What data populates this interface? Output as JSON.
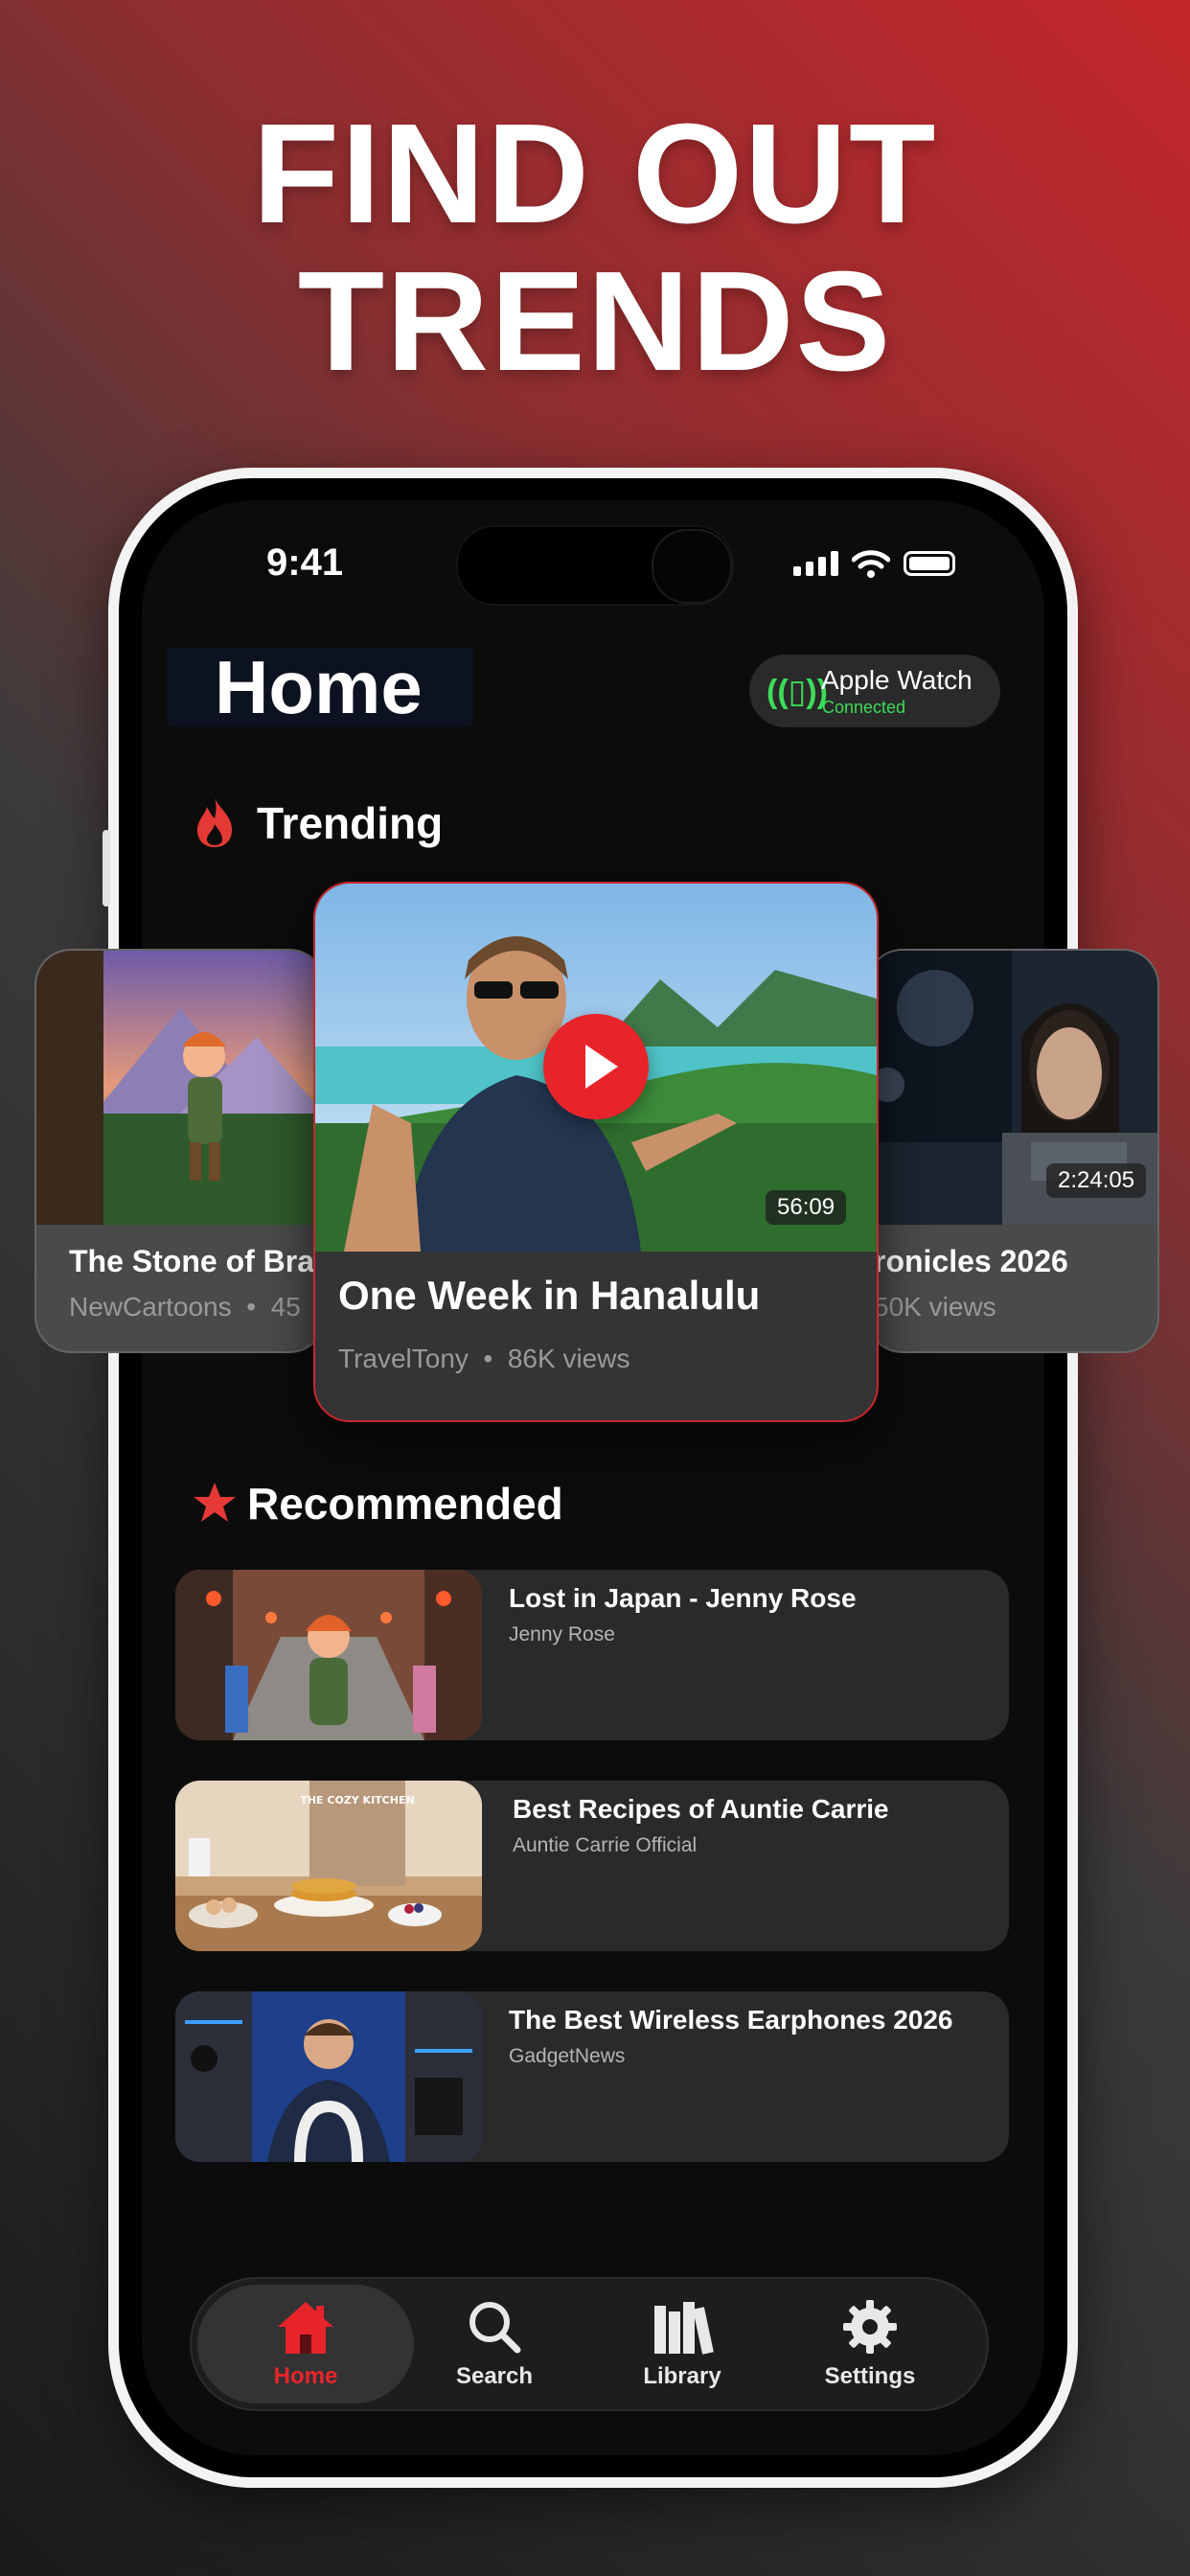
{
  "headline": {
    "line1": "FIND OUT",
    "line2": "TRENDS"
  },
  "status": {
    "time": "9:41"
  },
  "header": {
    "title": "Home",
    "watch_title": "Apple Watch",
    "watch_status": "Connected"
  },
  "trending": {
    "label": "Trending",
    "cards": [
      {
        "title": "The Stone of Brave",
        "channel": "NewCartoons",
        "views": "45",
        "duration": ""
      },
      {
        "title": "One Week in Hanalulu",
        "channel": "TravelTony",
        "views": "86K views",
        "duration": "56:09"
      },
      {
        "title": "ronicles 2026",
        "channel": "",
        "views": "50K views",
        "duration": "2:24:05"
      }
    ]
  },
  "recommended": {
    "label": "Recommended",
    "items": [
      {
        "title": "Lost in Japan - Jenny Rose",
        "channel": "Jenny Rose"
      },
      {
        "title": "Best Recipes of Auntie Carrie",
        "channel": "Auntie Carrie Official",
        "thumb_text": "THE COZY KITCHEN"
      },
      {
        "title": "The Best Wireless Earphones 2026",
        "channel": "GadgetNews"
      }
    ]
  },
  "tabs": [
    {
      "label": "Home",
      "icon": "house-icon",
      "active": true
    },
    {
      "label": "Search",
      "icon": "magnifier-icon",
      "active": false
    },
    {
      "label": "Library",
      "icon": "books-icon",
      "active": false
    },
    {
      "label": "Settings",
      "icon": "gear-icon",
      "active": false
    }
  ],
  "colors": {
    "accent": "#e8242b",
    "watch_green": "#3ddc5a",
    "screen_bg": "#0c0c0c"
  }
}
